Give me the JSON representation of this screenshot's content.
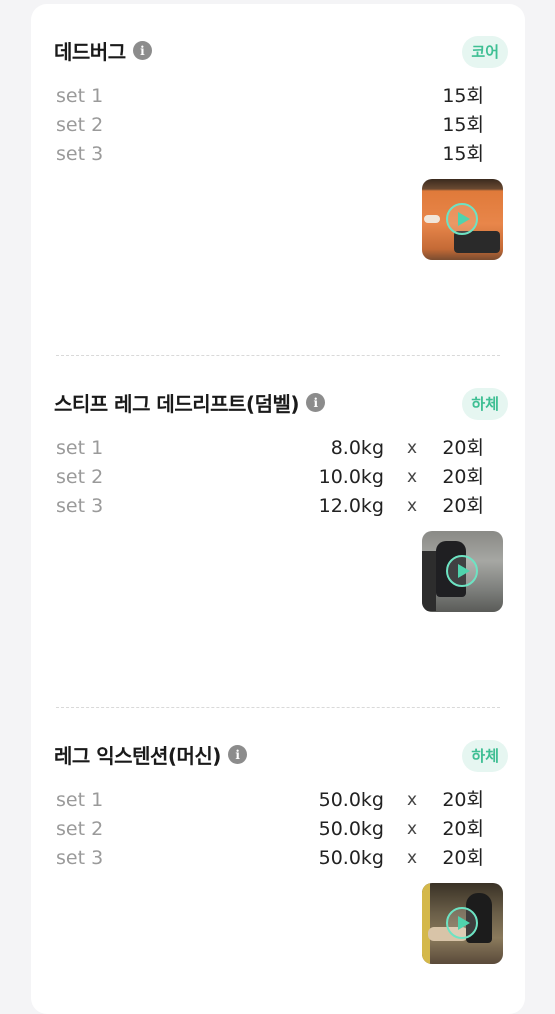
{
  "exercises": [
    {
      "title": "데드버그",
      "tag": "코어",
      "sets": [
        {
          "label": "set 1",
          "weight": "",
          "times": "",
          "reps": "15회"
        },
        {
          "label": "set 2",
          "weight": "",
          "times": "",
          "reps": "15회"
        },
        {
          "label": "set 3",
          "weight": "",
          "times": "",
          "reps": "15회"
        }
      ]
    },
    {
      "title": "스티프 레그 데드리프트(덤벨)",
      "tag": "하체",
      "sets": [
        {
          "label": "set 1",
          "weight": "8.0kg",
          "times": "x",
          "reps": "20회"
        },
        {
          "label": "set 2",
          "weight": "10.0kg",
          "times": "x",
          "reps": "20회"
        },
        {
          "label": "set 3",
          "weight": "12.0kg",
          "times": "x",
          "reps": "20회"
        }
      ]
    },
    {
      "title": "레그 익스텐션(머신)",
      "tag": "하체",
      "sets": [
        {
          "label": "set 1",
          "weight": "50.0kg",
          "times": "x",
          "reps": "20회"
        },
        {
          "label": "set 2",
          "weight": "50.0kg",
          "times": "x",
          "reps": "20회"
        },
        {
          "label": "set 3",
          "weight": "50.0kg",
          "times": "x",
          "reps": "20회"
        }
      ]
    }
  ],
  "info_icon_glyph": "i",
  "icons": {
    "info": "info-icon",
    "play": "play-icon"
  },
  "colors": {
    "tag_bg": "#e6f6f1",
    "tag_text": "#3fbf94",
    "play_accent": "#4fd3ad"
  }
}
